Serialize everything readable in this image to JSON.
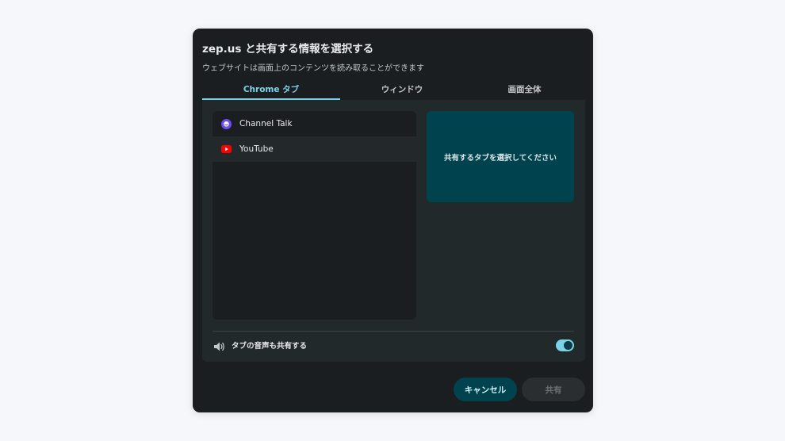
{
  "dialog": {
    "title": "zep.us と共有する情報を選択する",
    "subtitle": "ウェブサイトは画面上のコンテンツを読み取ることができます"
  },
  "tabs": [
    {
      "label": "Chrome タブ",
      "active": true
    },
    {
      "label": "ウィンドウ",
      "active": false
    },
    {
      "label": "画面全体",
      "active": false
    }
  ],
  "tab_list": [
    {
      "label": "Channel Talk",
      "icon": "channel-talk-icon",
      "selected": false
    },
    {
      "label": "YouTube",
      "icon": "youtube-icon",
      "selected": true
    }
  ],
  "preview": {
    "text": "共有するタブを選択してください"
  },
  "audio": {
    "label": "タブの音声も共有する",
    "icon": "speaker-icon",
    "enabled": true
  },
  "buttons": {
    "cancel_label": "キャンセル",
    "share_label": "共有"
  },
  "colors": {
    "accent": "#7cd3e7",
    "dialog_bg": "#1b1e20",
    "panel_bg": "#22292b",
    "preview_bg": "#00434f",
    "youtube_red": "#ff0000",
    "channel_talk_purple": "#6b4cf6"
  }
}
